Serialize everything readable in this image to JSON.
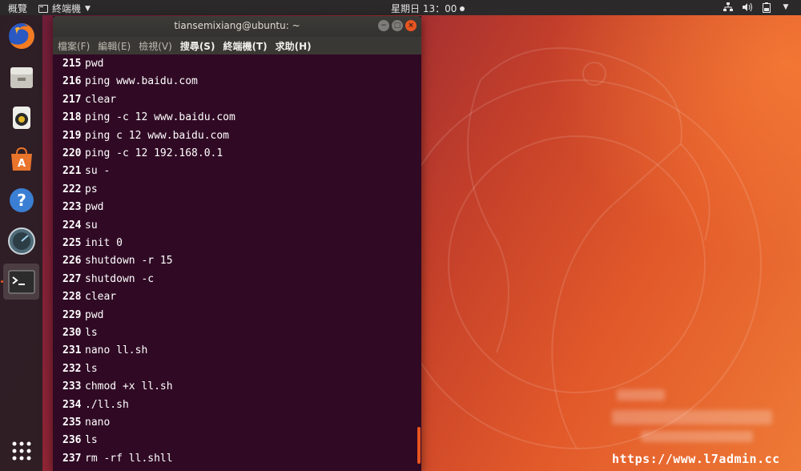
{
  "topbar": {
    "activities": "概覽",
    "app_name": "終端機",
    "clock": "星期日 13：00",
    "tray": [
      "network-icon",
      "volume-icon",
      "battery-icon",
      "system-menu-caret-icon"
    ]
  },
  "dock": {
    "items": [
      {
        "name": "firefox-icon",
        "active": false
      },
      {
        "name": "files-icon",
        "active": false
      },
      {
        "name": "rhythmbox-icon",
        "active": false
      },
      {
        "name": "software-center-icon",
        "active": false
      },
      {
        "name": "help-icon",
        "active": false
      },
      {
        "name": "dashboard-icon",
        "active": false
      },
      {
        "name": "terminal-icon",
        "active": true
      },
      {
        "name": "show-applications-icon",
        "active": false
      }
    ]
  },
  "window": {
    "title": "tiansemixiang@ubuntu: ~",
    "menu": [
      "檔案(F)",
      "編輯(E)",
      "檢視(V)",
      "搜尋(S)",
      "終端機(T)",
      "求助(H)"
    ],
    "buttons": {
      "minimize": "−",
      "maximize": "□",
      "close": "×"
    }
  },
  "terminal": {
    "lines": [
      {
        "num": "215",
        "cmd": "pwd"
      },
      {
        "num": "216",
        "cmd": "ping www.baidu.com"
      },
      {
        "num": "217",
        "cmd": "clear"
      },
      {
        "num": "218",
        "cmd": "ping -c 12 www.baidu.com"
      },
      {
        "num": "219",
        "cmd": "ping c 12 www.baidu.com"
      },
      {
        "num": "220",
        "cmd": "ping -c 12 192.168.0.1"
      },
      {
        "num": "221",
        "cmd": "su -"
      },
      {
        "num": "222",
        "cmd": "ps"
      },
      {
        "num": "223",
        "cmd": "pwd"
      },
      {
        "num": "224",
        "cmd": "su"
      },
      {
        "num": "225",
        "cmd": "init 0"
      },
      {
        "num": "226",
        "cmd": "shutdown -r 15"
      },
      {
        "num": "227",
        "cmd": "shutdown -c"
      },
      {
        "num": "228",
        "cmd": "clear"
      },
      {
        "num": "229",
        "cmd": "pwd"
      },
      {
        "num": "230",
        "cmd": "ls"
      },
      {
        "num": "231",
        "cmd": "nano ll.sh"
      },
      {
        "num": "232",
        "cmd": "ls"
      },
      {
        "num": "233",
        "cmd": "chmod +x ll.sh"
      },
      {
        "num": "234",
        "cmd": "./ll.sh"
      },
      {
        "num": "235",
        "cmd": "nano"
      },
      {
        "num": "236",
        "cmd": "ls"
      },
      {
        "num": "237",
        "cmd": "rm -rf ll.shll"
      }
    ]
  },
  "watermark": "https://www.l7admin.cc",
  "colors": {
    "terminal_bg": "#300a24",
    "accent": "#e95420",
    "topbar_bg": "#2b2929"
  }
}
